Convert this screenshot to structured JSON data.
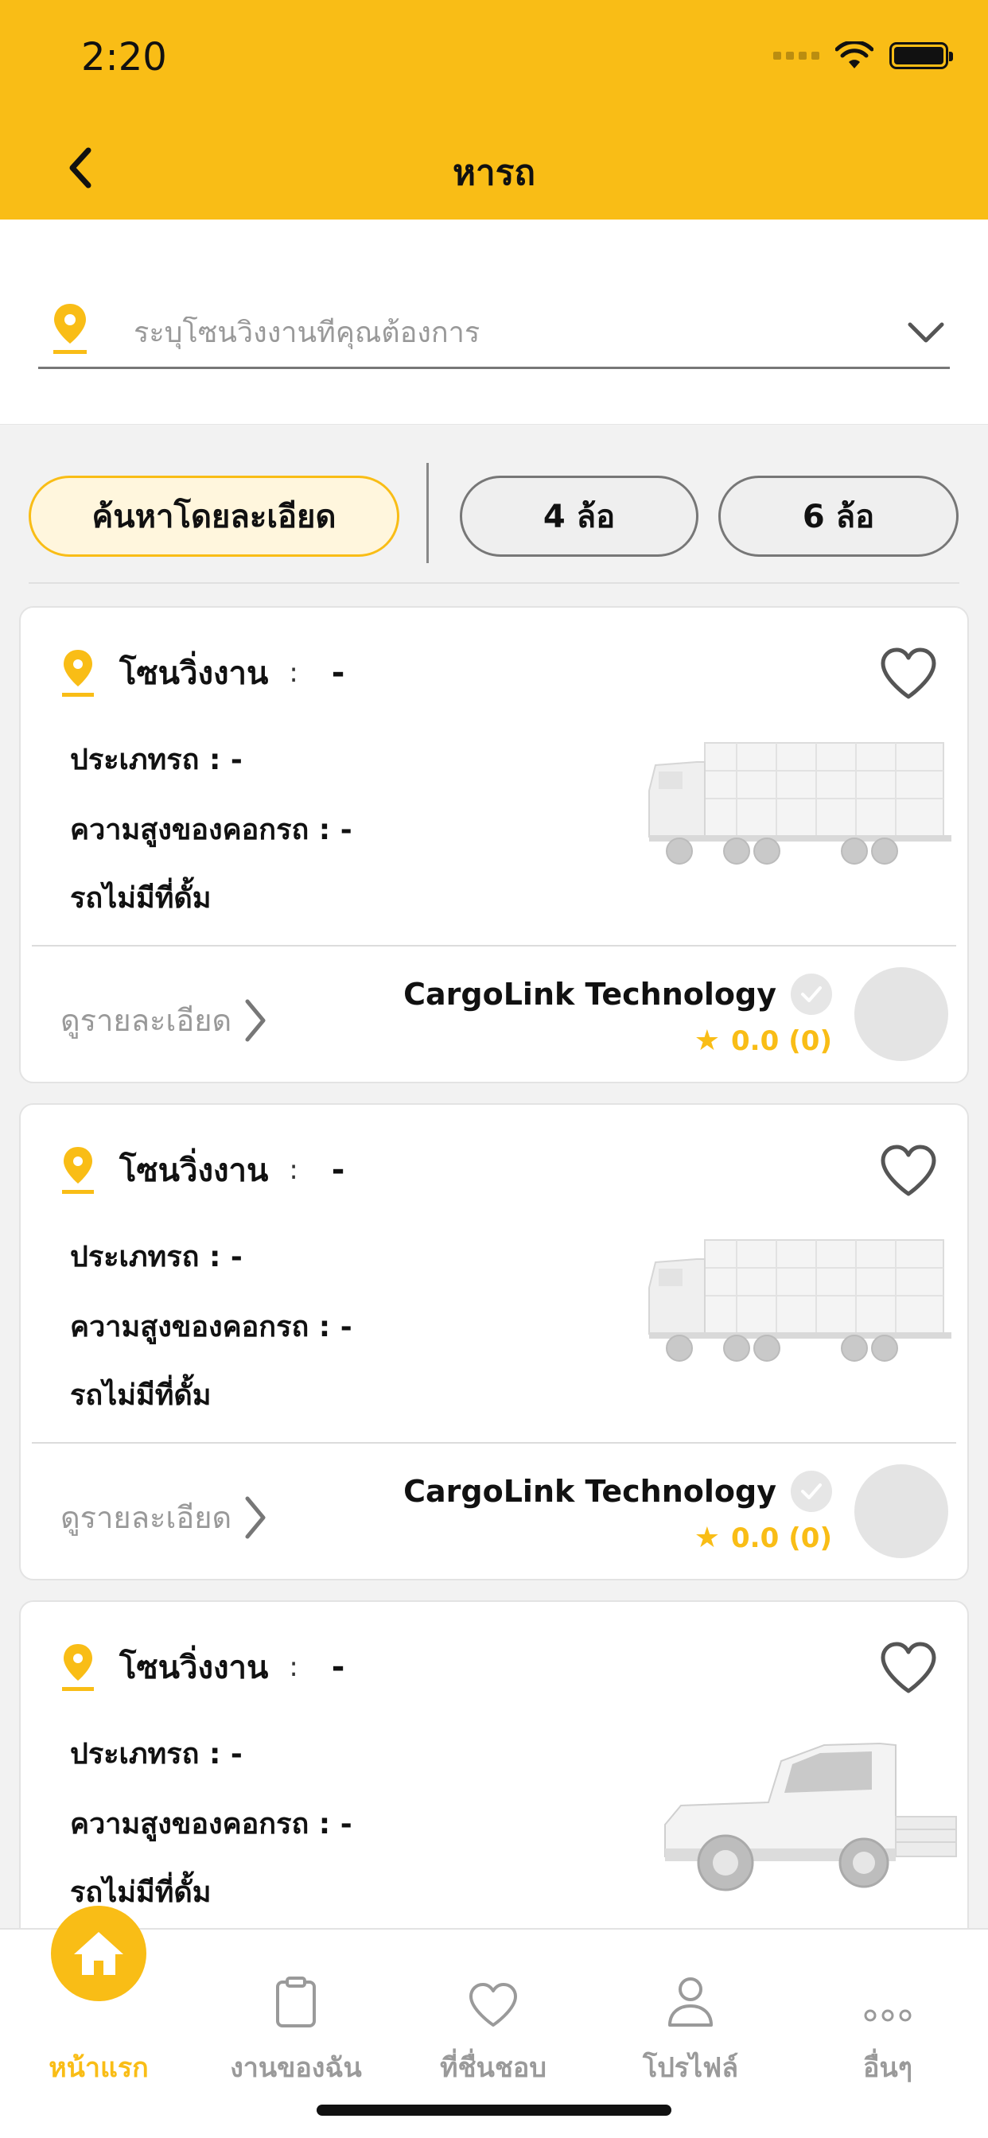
{
  "status_bar": {
    "time": "2:20"
  },
  "header": {
    "title": "หารถ"
  },
  "zone_selector": {
    "placeholder": "ระบุโซนวิ่งงานที่คุณต้องการ"
  },
  "filters": [
    {
      "label": "ค้นหาโดยละเอียด",
      "active": true
    },
    {
      "label": "4 ล้อ",
      "active": false
    },
    {
      "label": "6 ล้อ",
      "active": false
    }
  ],
  "cards": [
    {
      "zone_label": "โซนวิ่งงาน",
      "zone_colon": ":",
      "zone_value": "-",
      "vehicle_type": "ประเภทรถ : -",
      "cargo_height": "ความสูงของคอกรถ : -",
      "dump": "รถไม่มีที่ดั้ม",
      "vehicle_image": "truck-image",
      "detail_link": "ดูรายละเอียด",
      "company": "CargoLink Technology",
      "rating": "0.0",
      "rating_count": "(0)"
    },
    {
      "zone_label": "โซนวิ่งงาน",
      "zone_colon": ":",
      "zone_value": "-",
      "vehicle_type": "ประเภทรถ : -",
      "cargo_height": "ความสูงของคอกรถ : -",
      "dump": "รถไม่มีที่ดั้ม",
      "vehicle_image": "truck-image",
      "detail_link": "ดูรายละเอียด",
      "company": "CargoLink Technology",
      "rating": "0.0",
      "rating_count": "(0)"
    },
    {
      "zone_label": "โซนวิ่งงาน",
      "zone_colon": ":",
      "zone_value": "-",
      "vehicle_type": "ประเภทรถ : -",
      "cargo_height": "ความสูงของคอกรถ : -",
      "dump": "รถไม่มีที่ดั้ม",
      "vehicle_image": "pickup-image"
    }
  ],
  "bottom_nav": [
    {
      "label": "หน้าแรก",
      "icon": "home-icon",
      "active": true
    },
    {
      "label": "งานของฉัน",
      "icon": "clipboard-icon",
      "active": false
    },
    {
      "label": "ที่ชื่นชอบ",
      "icon": "heart-icon",
      "active": false
    },
    {
      "label": "โปรไฟล์",
      "icon": "user-icon",
      "active": false
    },
    {
      "label": "อื่นๆ",
      "icon": "more-icon",
      "active": false
    }
  ],
  "colors": {
    "brand_yellow": "#f9bd16",
    "muted_gray": "#9a9a9a"
  }
}
